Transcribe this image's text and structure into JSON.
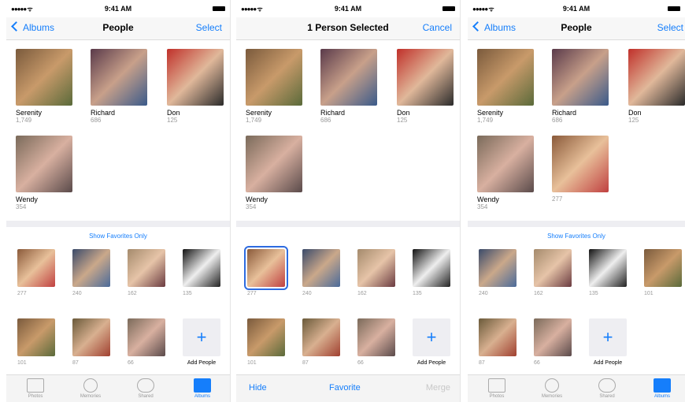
{
  "status": {
    "time": "9:41 AM",
    "signal": "●●●●● ᯤ"
  },
  "panel1": {
    "nav": {
      "back": "Albums",
      "title": "People",
      "right": "Select"
    },
    "people": [
      {
        "name": "Serenity",
        "count": "1,749"
      },
      {
        "name": "Richard",
        "count": "686"
      },
      {
        "name": "Don",
        "count": "125"
      },
      {
        "name": "Wendy",
        "count": "354"
      }
    ],
    "show_favorites": "Show Favorites Only",
    "faces": [
      "277",
      "240",
      "162",
      "135",
      "101",
      "87",
      "66"
    ],
    "add_people": "Add People",
    "tabs": [
      "Photos",
      "Memories",
      "Shared",
      "Albums"
    ]
  },
  "panel2": {
    "nav": {
      "title": "1 Person Selected",
      "right": "Cancel"
    },
    "people": [
      {
        "name": "Serenity",
        "count": "1,749"
      },
      {
        "name": "Richard",
        "count": "686"
      },
      {
        "name": "Don",
        "count": "125"
      },
      {
        "name": "Wendy",
        "count": "354"
      }
    ],
    "faces": [
      "277",
      "240",
      "162",
      "135",
      "101",
      "87",
      "66"
    ],
    "add_people": "Add People",
    "toolbar": {
      "hide": "Hide",
      "favorite": "Favorite",
      "merge": "Merge"
    }
  },
  "panel3": {
    "nav": {
      "back": "Albums",
      "title": "People",
      "right": "Select"
    },
    "people": [
      {
        "name": "Serenity",
        "count": "1,749"
      },
      {
        "name": "Richard",
        "count": "686"
      },
      {
        "name": "Don",
        "count": "125"
      },
      {
        "name": "Wendy",
        "count": "354"
      },
      {
        "name": "",
        "count": "277"
      }
    ],
    "show_favorites": "Show Favorites Only",
    "faces": [
      "240",
      "162",
      "135",
      "101",
      "87",
      "66"
    ],
    "add_people": "Add People",
    "tabs": [
      "Photos",
      "Memories",
      "Shared",
      "Albums"
    ]
  }
}
